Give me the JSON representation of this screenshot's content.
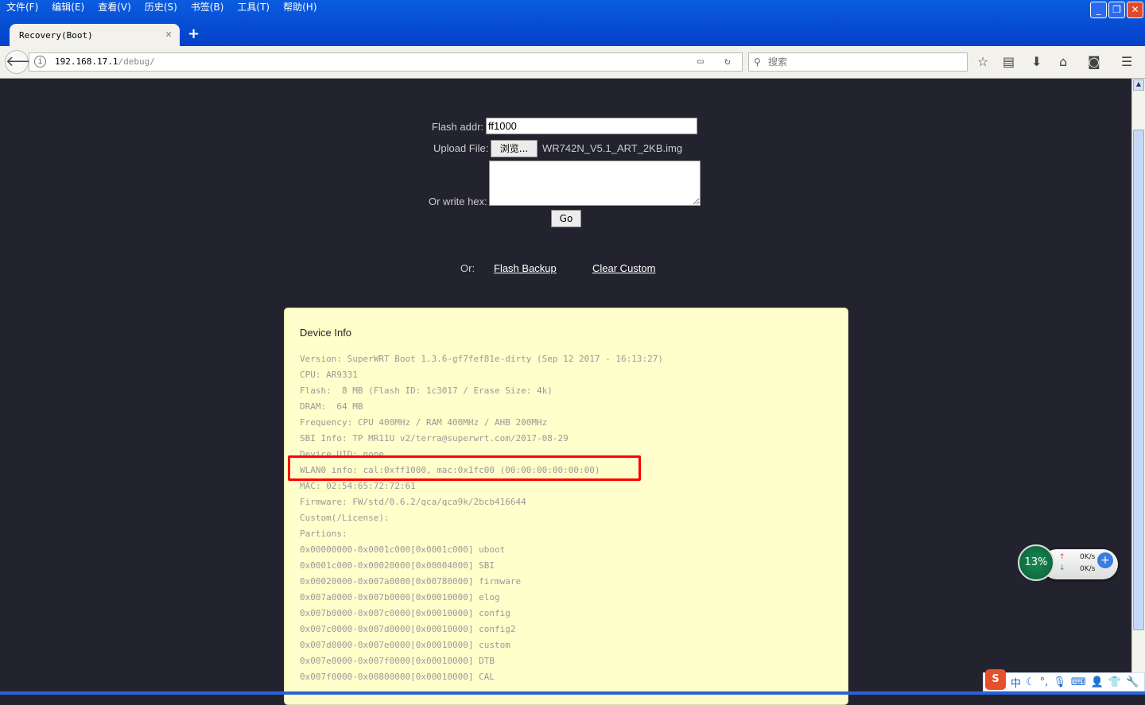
{
  "menu": [
    "文件(F)",
    "编辑(E)",
    "查看(V)",
    "历史(S)",
    "书签(B)",
    "工具(T)",
    "帮助(H)"
  ],
  "tab": {
    "title": "Recovery(Boot)"
  },
  "url": {
    "host": "192.168.17.1",
    "path": "/debug/"
  },
  "search": {
    "placeholder": "搜索"
  },
  "form": {
    "flash_addr_label": "Flash addr:",
    "flash_addr_value": "ff1000",
    "upload_label": "Upload File:",
    "browse_label": "浏览...",
    "file_name": "WR742N_V5.1_ART_2KB.img",
    "write_hex_label": "Or write hex:",
    "go_label": "Go",
    "or_label": "Or:",
    "flash_backup": "Flash Backup",
    "clear_custom": "Clear Custom"
  },
  "device_info": {
    "title": "Device Info",
    "lines": [
      "Version: SuperWRT Boot 1.3.6-gf7fef81e-dirty (Sep 12 2017 - 16:13:27)",
      "CPU: AR9331",
      "Flash:  8 MB (Flash ID: 1c3017 / Erase Size: 4k)",
      "DRAM:  64 MB",
      "Frequency: CPU 400MHz / RAM 400MHz / AHB 200MHz",
      "SBI Info: TP MR11U v2/terra@superwrt.com/2017-08-29",
      "Device UID: none",
      "WLAN0 info: cal:0xff1000, mac:0x1fc00 (00:00:00:00:00:00)",
      "MAC: 02:54:65:72:72:61",
      "Firmware: FW/std/0.6.2/qca/qca9k/2bcb416644",
      "Custom(/License):",
      "Partions:",
      "0x00000000-0x0001c000[0x0001c000] uboot",
      "0x0001c000-0x00020000[0x00004000] SBI",
      "0x00020000-0x007a0000[0x00780000] firmware",
      "0x007a0000-0x007b0000[0x00010000] elog",
      "0x007b0000-0x007c0000[0x00010000] config",
      "0x007c0000-0x007d0000[0x00010000] config2",
      "0x007d0000-0x007e0000[0x00010000] custom",
      "0x007e0000-0x007f0000[0x00010000] DTB",
      "0x007f0000-0x00800000[0x00010000] CAL"
    ]
  },
  "widget": {
    "percent": "13%",
    "up": "0K/s",
    "down": "0K/s"
  },
  "ime": {
    "mode": "中"
  },
  "colors": {
    "highlight": "#ff0000",
    "page_bg": "#23232f",
    "info_bg": "#ffffcc"
  }
}
